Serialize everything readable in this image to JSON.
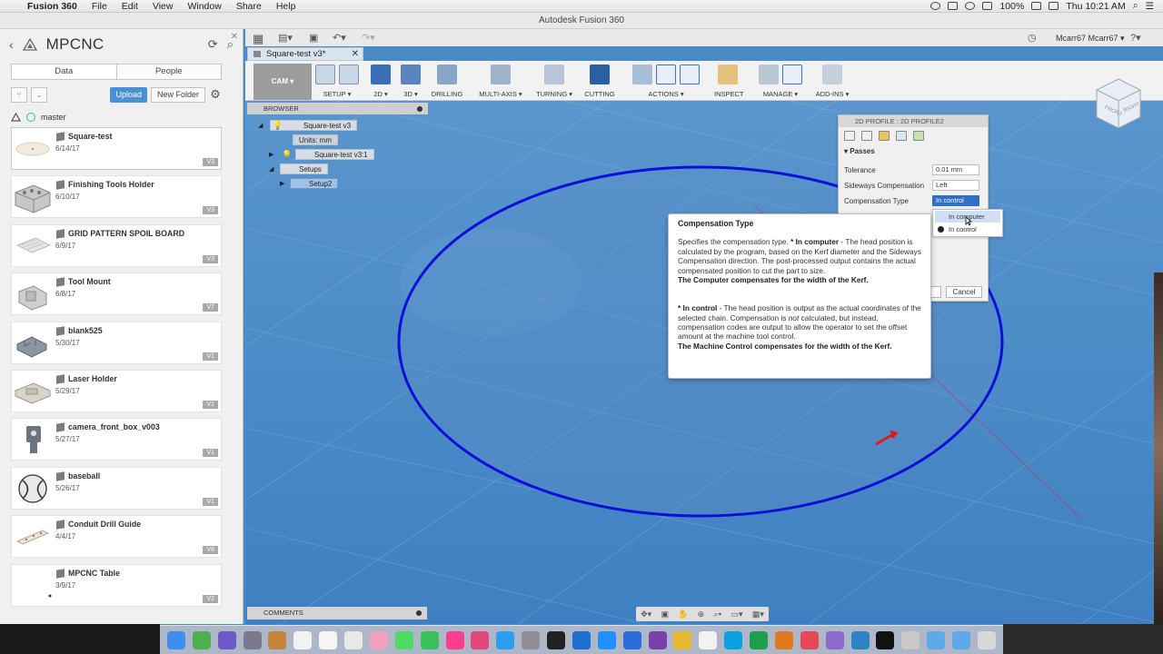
{
  "menubar": {
    "app": "Fusion 360",
    "items": [
      "File",
      "Edit",
      "View",
      "Window",
      "Share",
      "Help"
    ],
    "battery": "100%",
    "clock": "Thu 10:21 AM"
  },
  "window_title": "Autodesk Fusion 360",
  "data_panel": {
    "project": "MPCNC",
    "tabs": [
      "Data",
      "People"
    ],
    "upload_label": "Upload",
    "new_folder_label": "New Folder",
    "branch": "master",
    "files": [
      {
        "name": "Square-test",
        "date": "6/14/17",
        "version": "V3"
      },
      {
        "name": "Finishing Tools Holder",
        "date": "6/10/17",
        "version": "V3"
      },
      {
        "name": "GRID PATTERN SPOIL BOARD",
        "date": "6/9/17",
        "version": "V3"
      },
      {
        "name": "Tool Mount",
        "date": "6/8/17",
        "version": "V7"
      },
      {
        "name": "blank525",
        "date": "5/30/17",
        "version": "V1"
      },
      {
        "name": "Laser Holder",
        "date": "5/29/17",
        "version": "V1"
      },
      {
        "name": "camera_front_box_v003",
        "date": "5/27/17",
        "version": "V1"
      },
      {
        "name": "baseball",
        "date": "5/26/17",
        "version": "V1"
      },
      {
        "name": "Conduit Drill Guide",
        "date": "4/4/17",
        "version": "V6"
      },
      {
        "name": "MPCNC Table",
        "date": "3/9/17",
        "version": "V2"
      }
    ]
  },
  "toolbar": {
    "user": "Mcarr67 Mcarr67 ▾",
    "doc_tab": "Square-test v3*",
    "workspace": "CAM ▾",
    "groups": [
      {
        "label": "SETUP ▾"
      },
      {
        "label": "2D ▾"
      },
      {
        "label": "3D ▾"
      },
      {
        "label": "DRILLING"
      },
      {
        "label": "MULTI-AXIS ▾"
      },
      {
        "label": "TURNING ▾"
      },
      {
        "label": "CUTTING"
      },
      {
        "label": "ACTIONS ▾"
      },
      {
        "label": "INSPECT"
      },
      {
        "label": "MANAGE ▾"
      },
      {
        "label": "ADD-INS ▾"
      }
    ]
  },
  "browser": {
    "title": "BROWSER",
    "root": "Square-test v3",
    "units": "Units: mm",
    "component": "Square-test v3:1",
    "setups": "Setups",
    "setup": "Setup2"
  },
  "comments": "COMMENTS",
  "dialog": {
    "title": "2D PROFILE : 2D PROFILE2",
    "section": "Passes",
    "rows": [
      {
        "label": "Tolerance",
        "value": "0.01 mm"
      },
      {
        "label": "Sideways Compensation",
        "value": "Left"
      },
      {
        "label": "Compensation Type",
        "value": "In control"
      }
    ],
    "cancel": "Cancel",
    "dropdown": [
      "In computer",
      "In control"
    ]
  },
  "tooltip": {
    "title": "Compensation Type",
    "p1_intro": "Specifies the compensation type. ",
    "p1_term": "* In computer",
    "p1_text": " - The head position is calculated by the program, based on the Kerf diameter and the Sideways Compensation direction. The post-processed output contains the actual compensated position to cut the part to size.",
    "p1_bold": "The Computer compensates for the width of the Kerf.",
    "p2_term": "* In control",
    "p2_text_a": " - The head position is output as the actual coordinates of the selected chain. Compensation is ",
    "p2_em": "not",
    "p2_text_b": " calculated, but instead, compensation codes are output to allow the operator to set the offset amount at the machine tool control.",
    "p2_bold": "The Machine Control compensates for the width of the Kerf."
  },
  "colors": {
    "canvas": "#4a8bc7",
    "profile_circle": "#0a10d8",
    "accent": "#4a90d4"
  }
}
